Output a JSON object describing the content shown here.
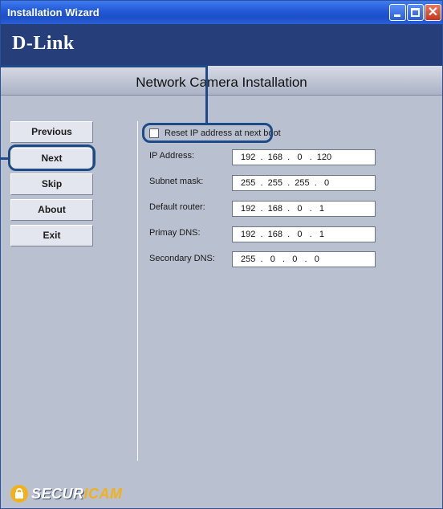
{
  "window": {
    "title": "Installation Wizard",
    "brand_logo": "D-Link",
    "header_title": "Network Camera Installation",
    "controls": {
      "minimize_icon": "minimize-icon",
      "maximize_icon": "maximize-icon",
      "close_icon": "close-icon",
      "close_glyph": "✕"
    }
  },
  "nav": {
    "previous": "Previous",
    "next": "Next",
    "skip": "Skip",
    "about": "About",
    "exit": "Exit"
  },
  "form": {
    "reset_checkbox": {
      "label": "Reset IP address at next boot",
      "checked": false
    },
    "fields": [
      {
        "label": "IP Address:",
        "value": "192  .  168  .   0   .  120"
      },
      {
        "label": "Subnet mask:",
        "value": "255  .  255  .  255  .   0"
      },
      {
        "label": "Default router:",
        "value": "192  .  168  .   0   .   1"
      },
      {
        "label": "Primay DNS:",
        "value": "192  .  168  .   0   .   1"
      },
      {
        "label": "Secondary DNS:",
        "value": "255  .   0   .   0   .   0"
      }
    ]
  },
  "footer": {
    "logo_part1": "SECUR",
    "logo_part2": "ICAM",
    "icon": "lock-icon"
  },
  "colors": {
    "titlebar": "#2358d6",
    "brand_band": "#263f7b",
    "panel": "#b9c0cf",
    "highlight": "#1e4b88",
    "securicam_accent": "#f2b11a"
  }
}
